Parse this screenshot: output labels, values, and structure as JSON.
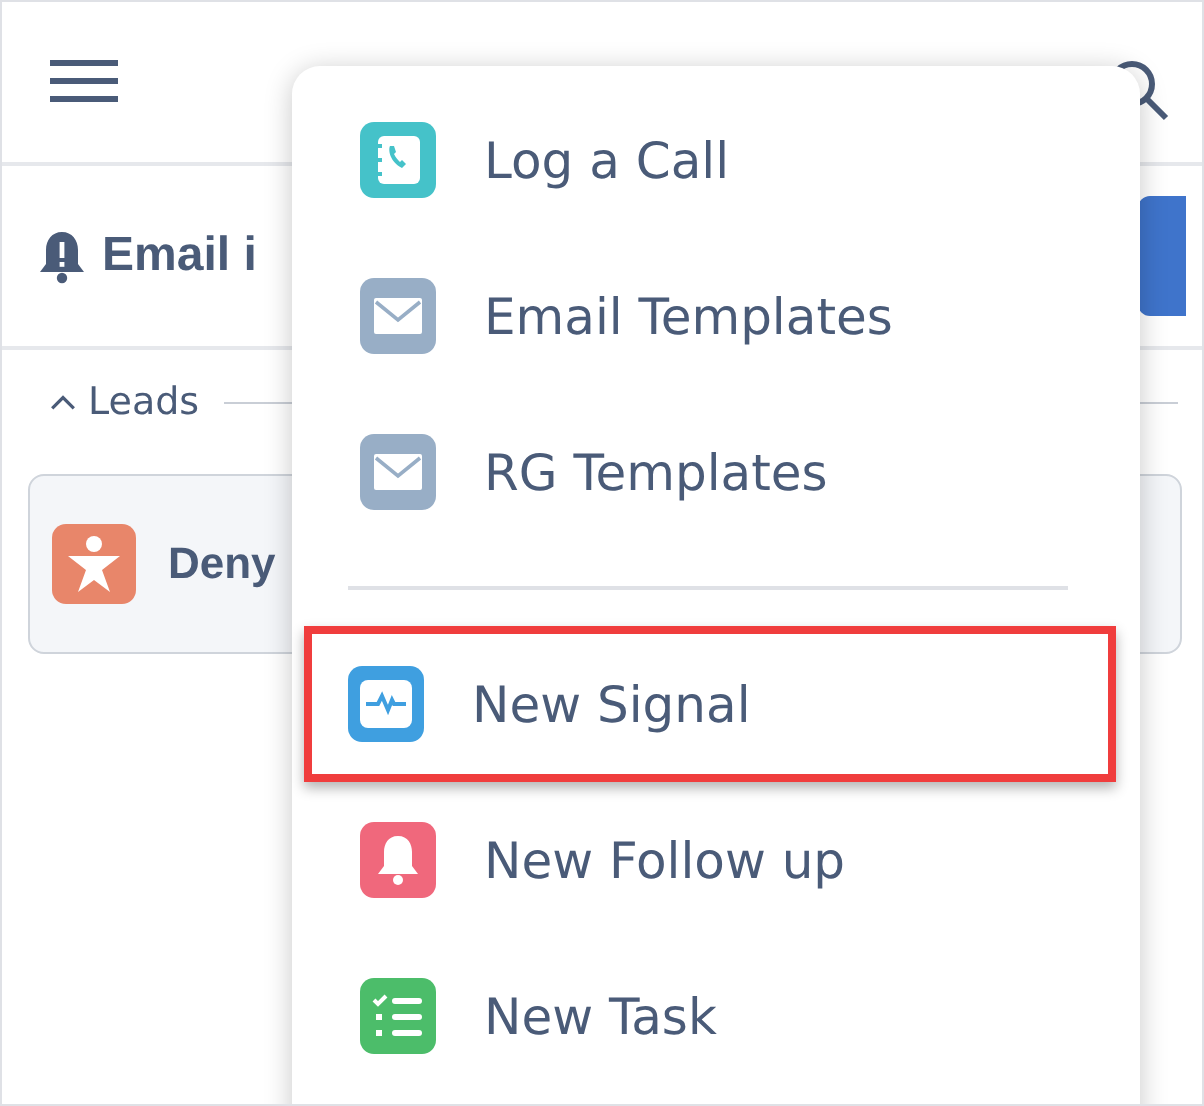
{
  "alert": {
    "title": "Email i"
  },
  "section": {
    "label": "Leads",
    "expanded": true
  },
  "lead_card": {
    "name": "Deny"
  },
  "menu": {
    "items": [
      {
        "kind": "call-log",
        "label": "Log a Call",
        "highlighted": false
      },
      {
        "kind": "email",
        "label": "Email Templates",
        "highlighted": false
      },
      {
        "kind": "email",
        "label": "RG Templates",
        "highlighted": false
      },
      {
        "kind": "divider"
      },
      {
        "kind": "signal",
        "label": "New Signal",
        "highlighted": true
      },
      {
        "kind": "follow-up",
        "label": "New Follow up",
        "highlighted": false
      },
      {
        "kind": "task",
        "label": "New Task",
        "highlighted": false
      }
    ]
  }
}
